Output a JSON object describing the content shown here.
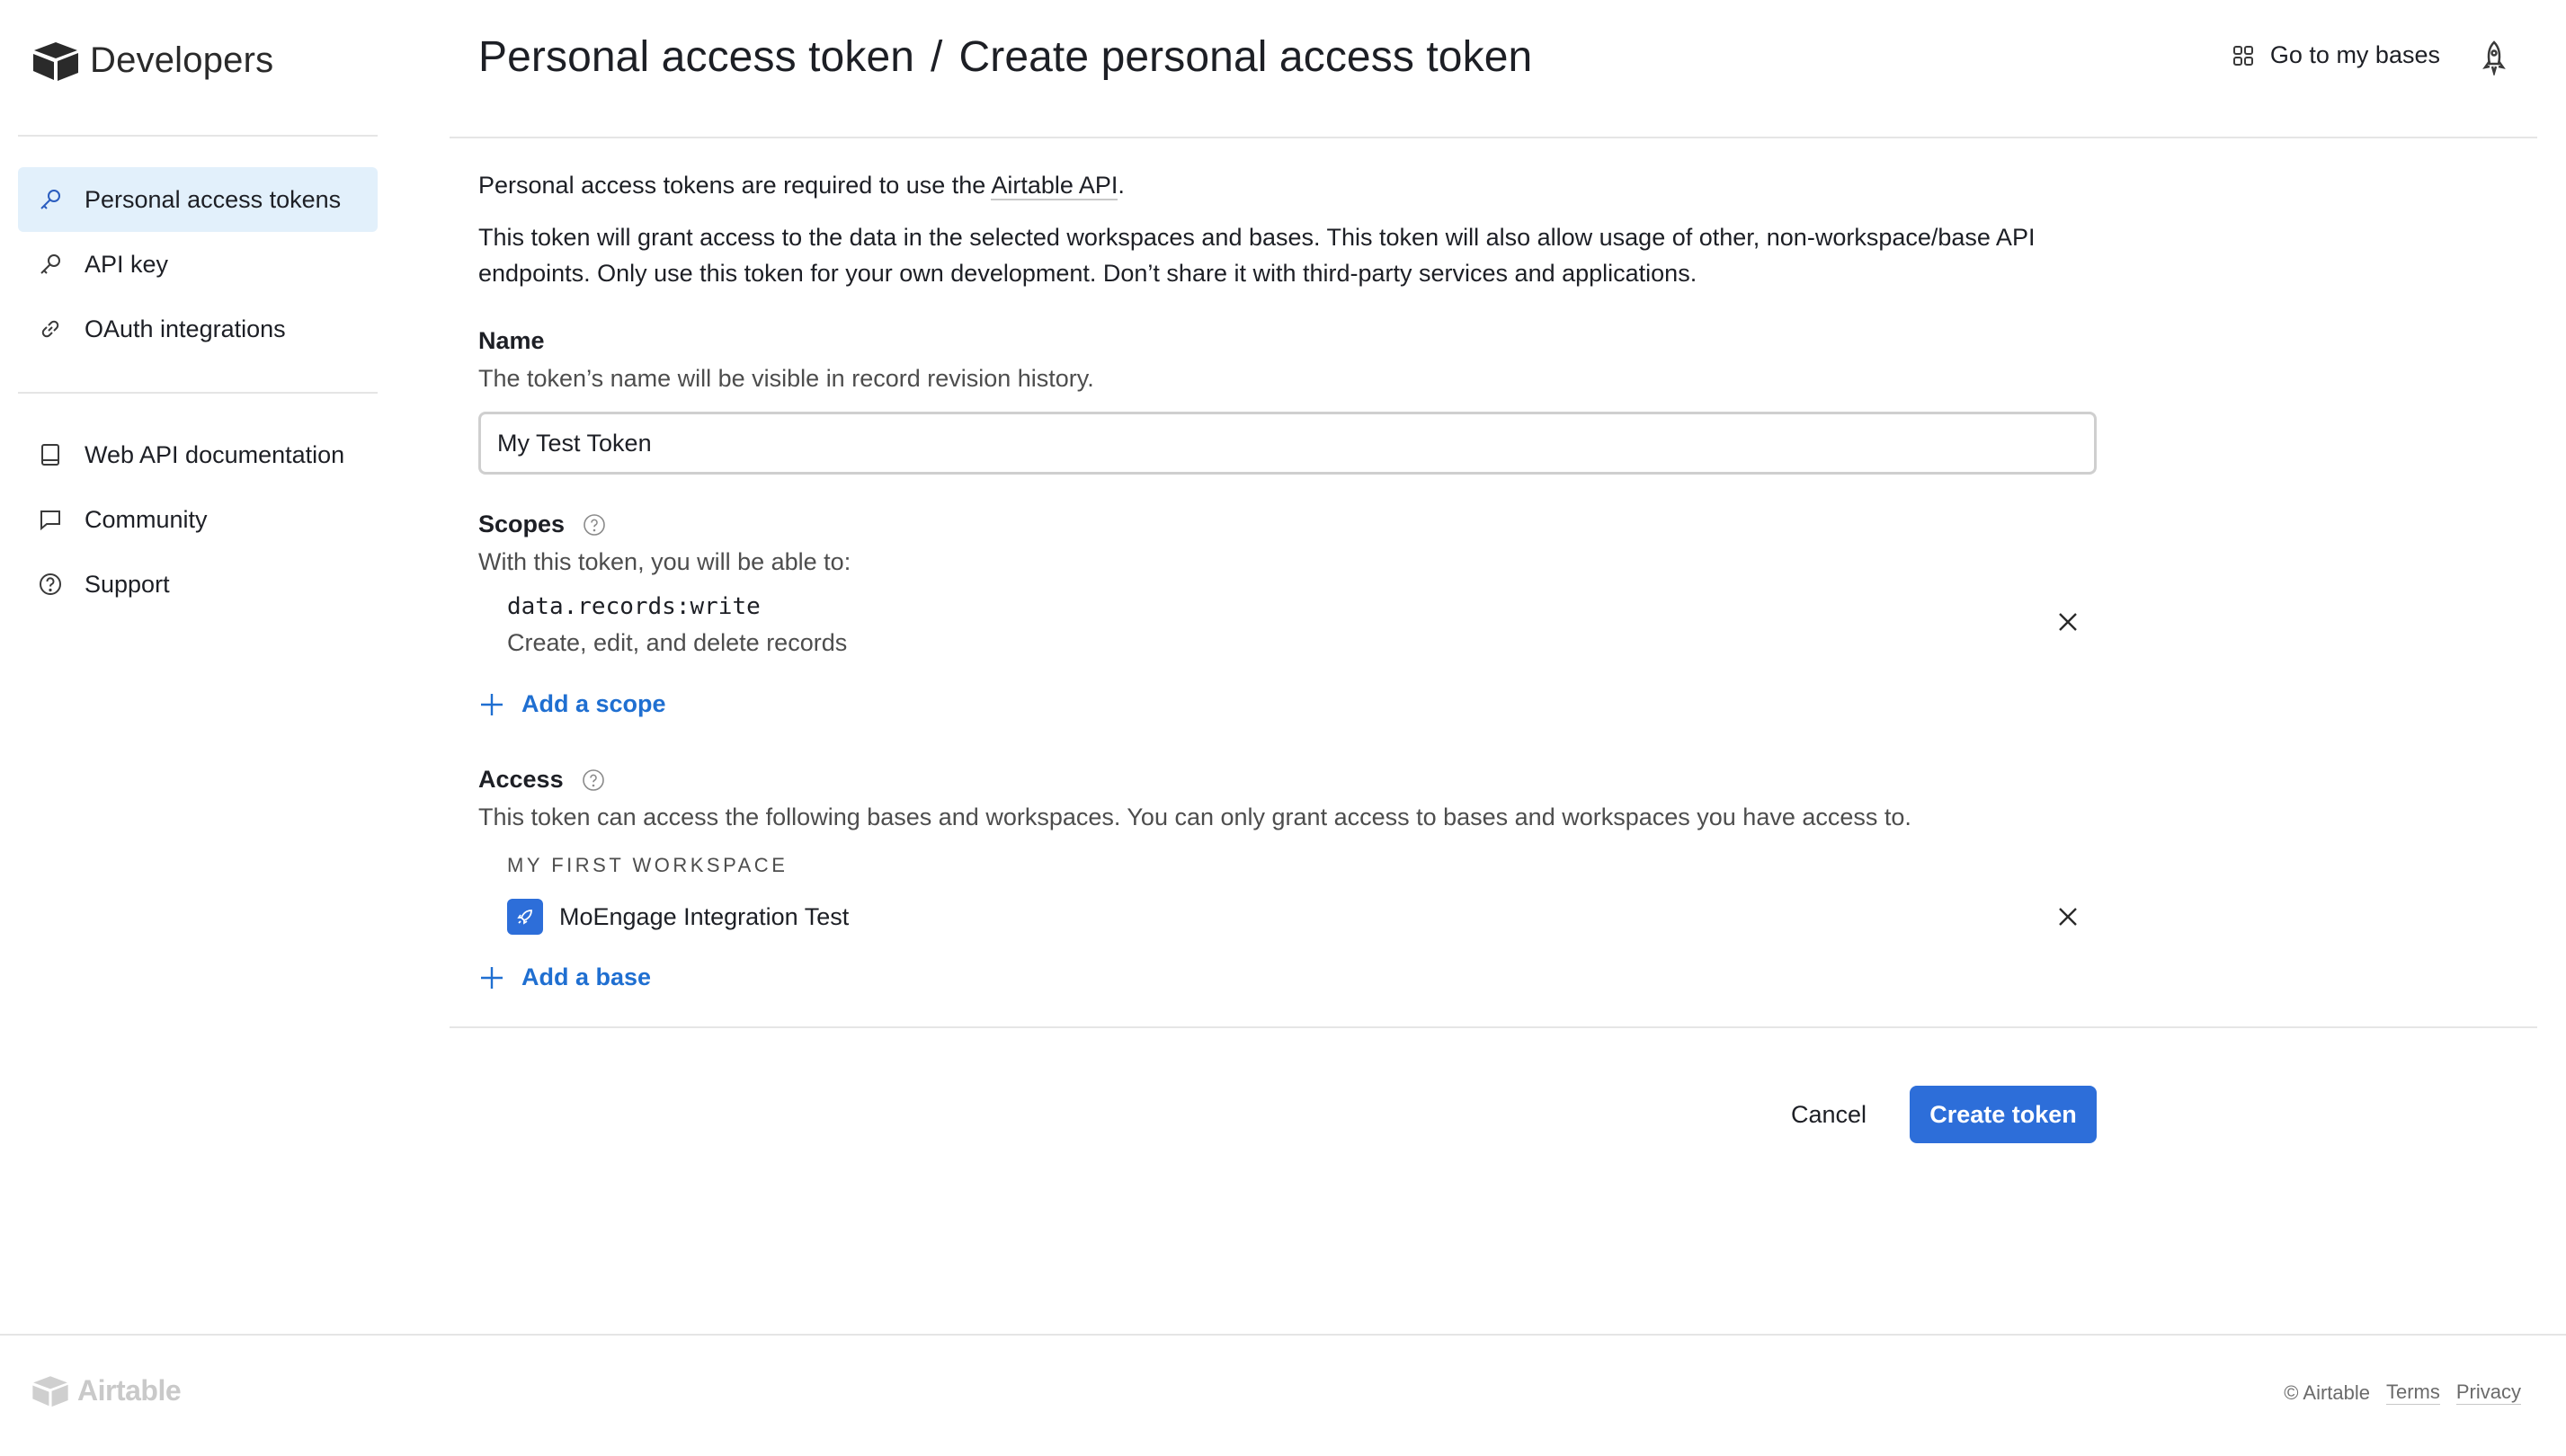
{
  "brand": {
    "name": "Developers"
  },
  "sidebar": {
    "items": [
      {
        "label": "Personal access tokens",
        "icon": "key-icon",
        "active": true
      },
      {
        "label": "API key",
        "icon": "key-icon"
      },
      {
        "label": "OAuth integrations",
        "icon": "link-icon"
      },
      {
        "label": "Web API documentation",
        "icon": "book-icon"
      },
      {
        "label": "Community",
        "icon": "chat-icon"
      },
      {
        "label": "Support",
        "icon": "question-circle-icon"
      }
    ]
  },
  "header": {
    "breadcrumb_parent": "Personal access token",
    "separator": "/",
    "breadcrumb_current": "Create personal access token",
    "go_to_bases": "Go to my bases"
  },
  "intro": {
    "line1_prefix": "Personal access tokens are required to use the ",
    "line1_link": "Airtable API",
    "line1_suffix": ".",
    "line2": "This token will grant access to the data in the selected workspaces and bases. This token will also allow usage of other, non-workspace/base API",
    "line3": "endpoints. Only use this token for your own development. Don’t share it with third-party services and applications."
  },
  "name_section": {
    "label": "Name",
    "hint": "The token’s name will be visible in record revision history.",
    "value": "My Test Token"
  },
  "scopes_section": {
    "label": "Scopes",
    "hint": "With this token, you will be able to:",
    "scopes": [
      {
        "code": "data.records:write",
        "description": "Create, edit, and delete records"
      }
    ],
    "add_label": "Add a scope"
  },
  "access_section": {
    "label": "Access",
    "hint": "This token can access the following bases and workspaces. You can only grant access to bases and workspaces you have access to.",
    "workspace": "MY FIRST WORKSPACE",
    "bases": [
      {
        "name": "MoEngage Integration Test"
      }
    ],
    "add_label": "Add a base"
  },
  "actions": {
    "cancel": "Cancel",
    "create": "Create token"
  },
  "footer": {
    "logo": "Airtable",
    "copyright": "© Airtable",
    "terms": "Terms",
    "privacy": "Privacy"
  },
  "colors": {
    "accent": "#2d6ed9",
    "link": "#1f6fd1",
    "active_bg": "#e2f0fb"
  }
}
